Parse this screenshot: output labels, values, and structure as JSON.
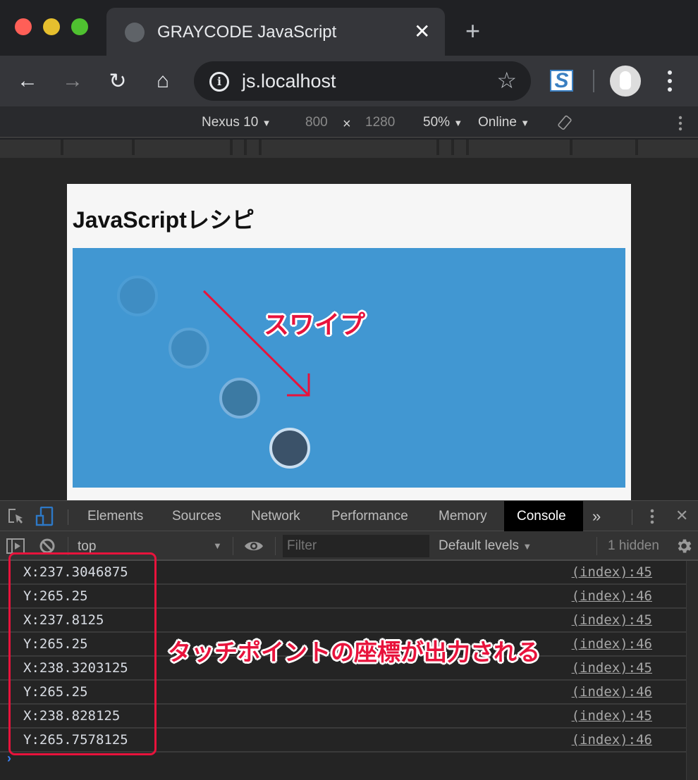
{
  "browser": {
    "traffic_lights": {
      "close": "#ff5f57",
      "minimize": "#e6bf2e",
      "maximize": "#4fc130"
    },
    "tab": {
      "title": "GRAYCODE JavaScript",
      "favicon": "globe-icon",
      "close_glyph": "✕"
    },
    "new_tab_glyph": "+",
    "toolbar": {
      "back_glyph": "←",
      "forward_glyph": "→",
      "reload_glyph": "↻",
      "home_glyph": "⌂",
      "url": "js.localhost",
      "info_glyph": "i",
      "bookmark_glyph": "☆",
      "extension_label": "S"
    }
  },
  "device_toolbar": {
    "device": "Nexus 10",
    "width": "800",
    "times": "×",
    "height": "1280",
    "zoom": "50%",
    "throttle": "Online",
    "dropdown_glyph": "▼"
  },
  "page": {
    "title": "JavaScriptレシピ",
    "swipe_label": "スワイプ",
    "accent_color": "#4197d2",
    "annotation_color": "#e8133c",
    "touch_trail_count": 4
  },
  "devtools": {
    "tabs": [
      {
        "label": "Elements",
        "active": false
      },
      {
        "label": "Sources",
        "active": false
      },
      {
        "label": "Network",
        "active": false
      },
      {
        "label": "Performance",
        "active": false
      },
      {
        "label": "Memory",
        "active": false
      },
      {
        "label": "Console",
        "active": true
      }
    ],
    "more_tabs_glyph": "»",
    "close_glyph": "✕",
    "filter_bar": {
      "context": "top",
      "filter_placeholder": "Filter",
      "levels": "Default levels",
      "hidden_count": "1 hidden"
    },
    "console_logs": [
      {
        "message": "X:237.3046875",
        "source": "(index):45"
      },
      {
        "message": "Y:265.25",
        "source": "(index):46"
      },
      {
        "message": "X:237.8125",
        "source": "(index):45"
      },
      {
        "message": "Y:265.25",
        "source": "(index):46"
      },
      {
        "message": "X:238.3203125",
        "source": "(index):45"
      },
      {
        "message": "Y:265.25",
        "source": "(index):46"
      },
      {
        "message": "X:238.828125",
        "source": "(index):45"
      },
      {
        "message": "Y:265.7578125",
        "source": "(index):46"
      }
    ],
    "prompt_glyph": "›"
  },
  "annotation": {
    "text": "タッチポイントの座標が出力される"
  }
}
